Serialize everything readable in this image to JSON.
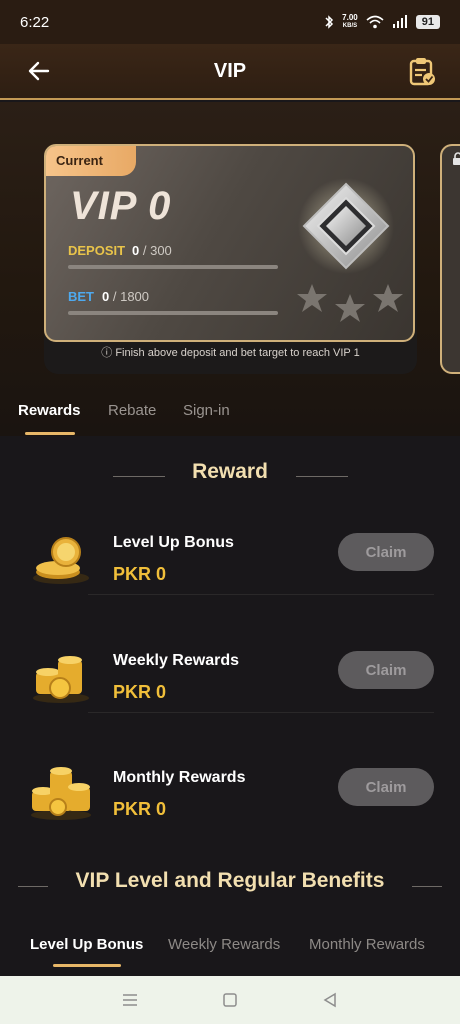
{
  "status_bar": {
    "time": "6:22",
    "net_speed": "7.00",
    "net_unit": "KB/S",
    "battery": "91"
  },
  "header": {
    "title": "VIP"
  },
  "vip_card": {
    "tag": "Current",
    "level": "VIP 0",
    "deposit_label": "DEPOSIT",
    "deposit_current": "0",
    "deposit_target": "/ 300",
    "deposit_progress": 0,
    "bet_label": "BET",
    "bet_current": "0",
    "bet_target": "/ 1800",
    "bet_progress": 0,
    "note": "Finish above deposit and bet target to reach VIP 1"
  },
  "tabs": [
    {
      "label": "Rewards",
      "active": true
    },
    {
      "label": "Rebate",
      "active": false
    },
    {
      "label": "Sign-in",
      "active": false
    }
  ],
  "reward": {
    "title": "Reward",
    "items": [
      {
        "name": "Level Up Bonus",
        "amount": "PKR 0",
        "button": "Claim"
      },
      {
        "name": "Weekly Rewards",
        "amount": "PKR 0",
        "button": "Claim"
      },
      {
        "name": "Monthly Rewards",
        "amount": "PKR 0",
        "button": "Claim"
      }
    ]
  },
  "benefits": {
    "title": "VIP Level and Regular Benefits",
    "tabs": [
      {
        "label": "Level Up Bonus",
        "active": true
      },
      {
        "label": "Weekly Rewards",
        "active": false
      },
      {
        "label": "Monthly Rewards",
        "active": false
      }
    ]
  },
  "colors": {
    "accent_gold": "#e7b768",
    "amount_gold": "#f1bf3a",
    "deposit_label": "#e9c44a",
    "bet_label": "#4ea9ee"
  }
}
